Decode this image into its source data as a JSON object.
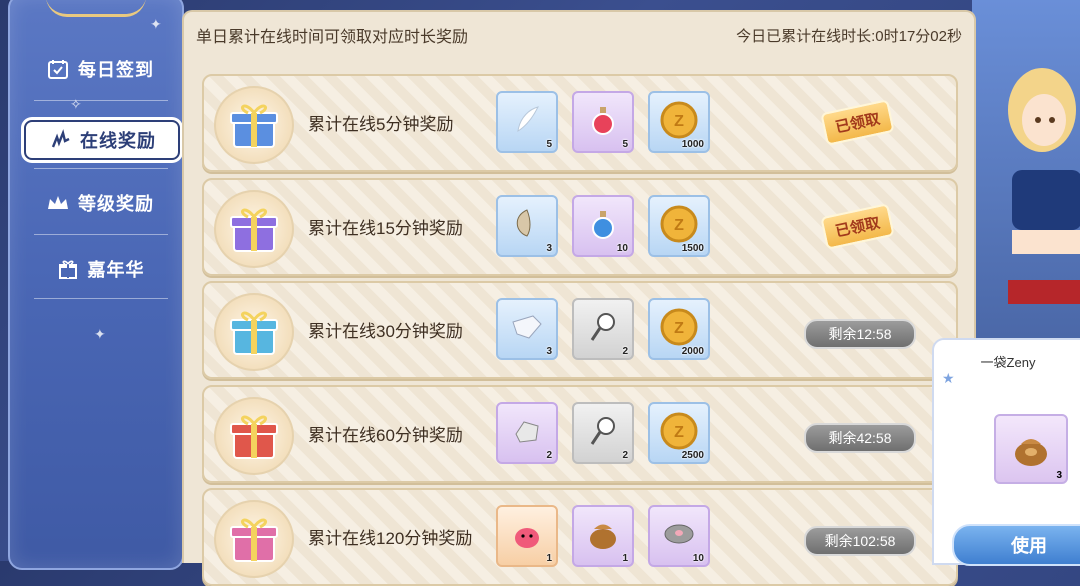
{
  "sidebar": {
    "items": [
      {
        "label": "每日签到",
        "icon": "calendar-check-icon",
        "active": false
      },
      {
        "label": "在线奖励",
        "icon": "sparkle-icon",
        "active": true
      },
      {
        "label": "等级奖励",
        "icon": "crown-icon",
        "active": false
      },
      {
        "label": "嘉年华",
        "icon": "gift-icon",
        "active": false
      }
    ]
  },
  "header": {
    "title": "单日累计在线时间可领取对应时长奖励",
    "online_time_label": "今日已累计在线时长:0时17分02秒"
  },
  "rows": [
    {
      "title": "累计在线5分钟奖励",
      "gift_color": "#5b8fe0",
      "items": [
        {
          "name": "feather",
          "qty": "5",
          "bg": "blue"
        },
        {
          "name": "red-potion",
          "qty": "5",
          "bg": "purple"
        },
        {
          "name": "zeny-coin",
          "qty": "1000",
          "bg": "blue"
        }
      ],
      "status_type": "claimed",
      "status": "已领取"
    },
    {
      "title": "累计在线15分钟奖励",
      "gift_color": "#8e6fe0",
      "items": [
        {
          "name": "butterfly-wing",
          "qty": "3",
          "bg": "blue"
        },
        {
          "name": "blue-potion",
          "qty": "10",
          "bg": "purple"
        },
        {
          "name": "zeny-coin",
          "qty": "1500",
          "bg": "blue"
        }
      ],
      "status_type": "claimed",
      "status": "已领取"
    },
    {
      "title": "累计在线30分钟奖励",
      "gift_color": "#57b6e0",
      "items": [
        {
          "name": "crystal-shard",
          "qty": "3",
          "bg": "blue"
        },
        {
          "name": "magnifier",
          "qty": "2",
          "bg": "gray"
        },
        {
          "name": "zeny-coin",
          "qty": "2000",
          "bg": "blue"
        }
      ],
      "status_type": "timer",
      "status": "剩余12:58"
    },
    {
      "title": "累计在线60分钟奖励",
      "gift_color": "#e0574b",
      "items": [
        {
          "name": "ore",
          "qty": "2",
          "bg": "purple"
        },
        {
          "name": "magnifier",
          "qty": "2",
          "bg": "gray"
        },
        {
          "name": "zeny-coin",
          "qty": "2500",
          "bg": "blue"
        }
      ],
      "status_type": "timer",
      "status": "剩余42:58"
    },
    {
      "title": "累计在线120分钟奖励",
      "gift_color": "#e06fa8",
      "items": [
        {
          "name": "poring",
          "qty": "1",
          "bg": "orange"
        },
        {
          "name": "zeny-bag",
          "qty": "1",
          "bg": "purple"
        },
        {
          "name": "stone-disc",
          "qty": "10",
          "bg": "purple"
        }
      ],
      "status_type": "timer",
      "status": "剩余102:58"
    }
  ],
  "tooltip": {
    "item_name": "一袋Zeny",
    "qty": "3",
    "use_label": "使用"
  }
}
